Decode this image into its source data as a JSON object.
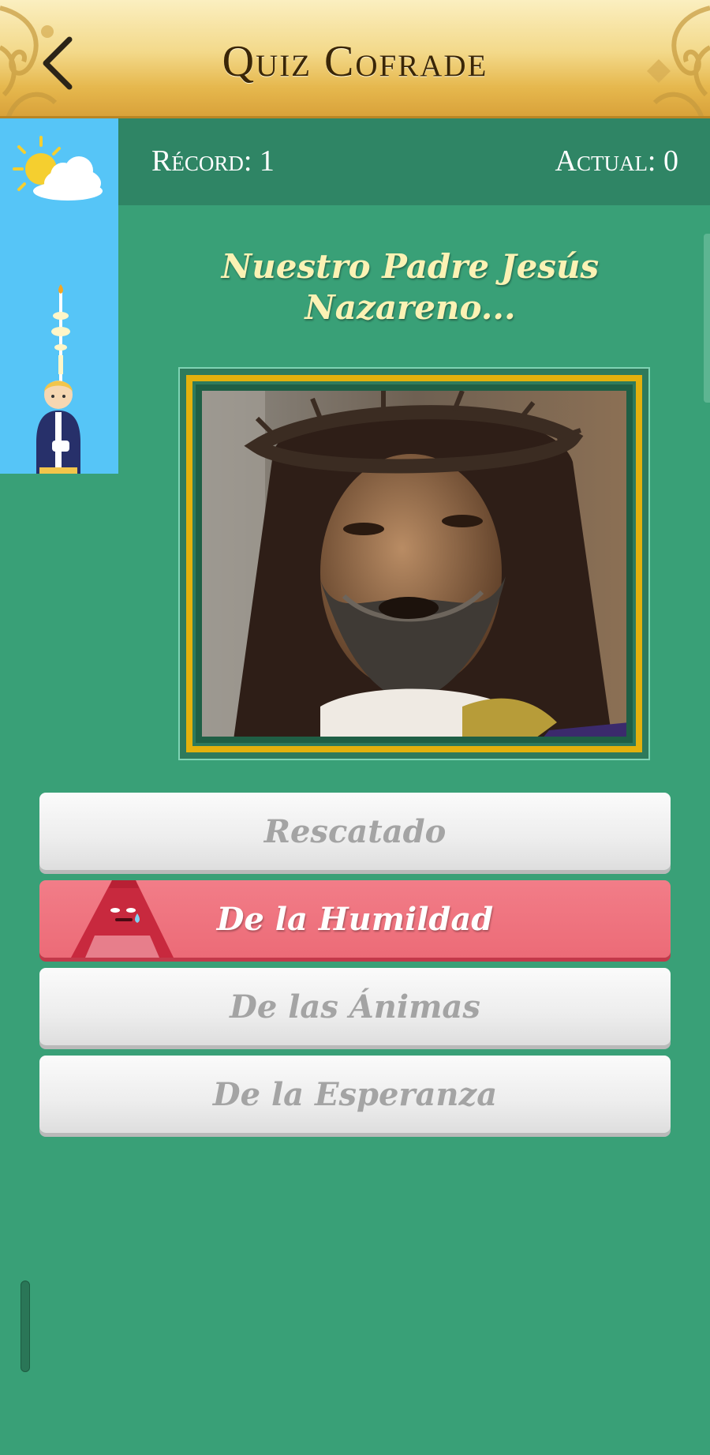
{
  "header": {
    "title": "Quiz Cofrade",
    "back_label": "Back"
  },
  "score": {
    "record_label": "Récord: 1",
    "current_label": "Actual: 0"
  },
  "question": {
    "line1": "Nuestro Padre Jesús",
    "line2": "Nazareno..."
  },
  "answers": [
    {
      "label": "Rescatado",
      "state": "neutral"
    },
    {
      "label": "De la Humildad",
      "state": "wrong"
    },
    {
      "label": "De las Ánimas",
      "state": "neutral"
    },
    {
      "label": "De la Esperanza",
      "state": "neutral"
    }
  ],
  "colors": {
    "background": "#39a077",
    "score_bar": "#2f8565",
    "wrong": "#ec6b77",
    "gold": "#e3b10d",
    "sky": "#56c5f7"
  },
  "icons": [
    "chevron-left-icon",
    "sun-cloud-icon",
    "nazareno-candle-icon",
    "sad-capirote-icon"
  ]
}
